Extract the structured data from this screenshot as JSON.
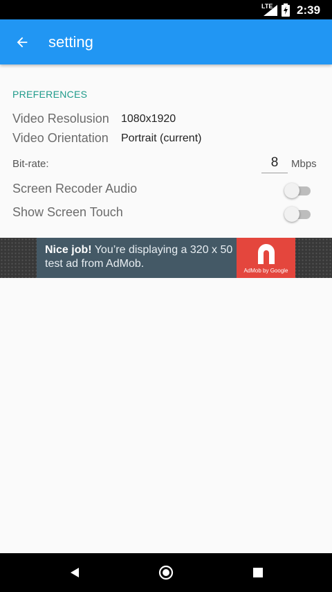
{
  "status_bar": {
    "network": "LTE",
    "time": "2:39",
    "icons": [
      "signal-icon",
      "battery-charging-icon"
    ]
  },
  "app_bar": {
    "back_icon": "arrow-left-icon",
    "title": "setting",
    "color": "#2196f3"
  },
  "preferences": {
    "header": "PREFERENCES",
    "video_resolution": {
      "label": "Video Resolusion",
      "value": "1080x1920"
    },
    "video_orientation": {
      "label": "Video Orientation",
      "value": "Portrait (current)"
    },
    "bitrate": {
      "label": "Bit-rate:",
      "value": "8",
      "unit": "Mbps"
    },
    "screen_recorder_audio": {
      "label": "Screen Recoder Audio",
      "enabled": false
    },
    "show_screen_touch": {
      "label": "Show Screen Touch",
      "enabled": false
    }
  },
  "ad": {
    "headline": "Nice job!",
    "body": " You’re displaying a 320 x 50 test ad from AdMob.",
    "logo_caption": "AdMob by Google",
    "logo_color": "#e4463d"
  },
  "nav_bar": {
    "icons": [
      "back-triangle-icon",
      "home-circle-icon",
      "recents-square-icon"
    ]
  }
}
